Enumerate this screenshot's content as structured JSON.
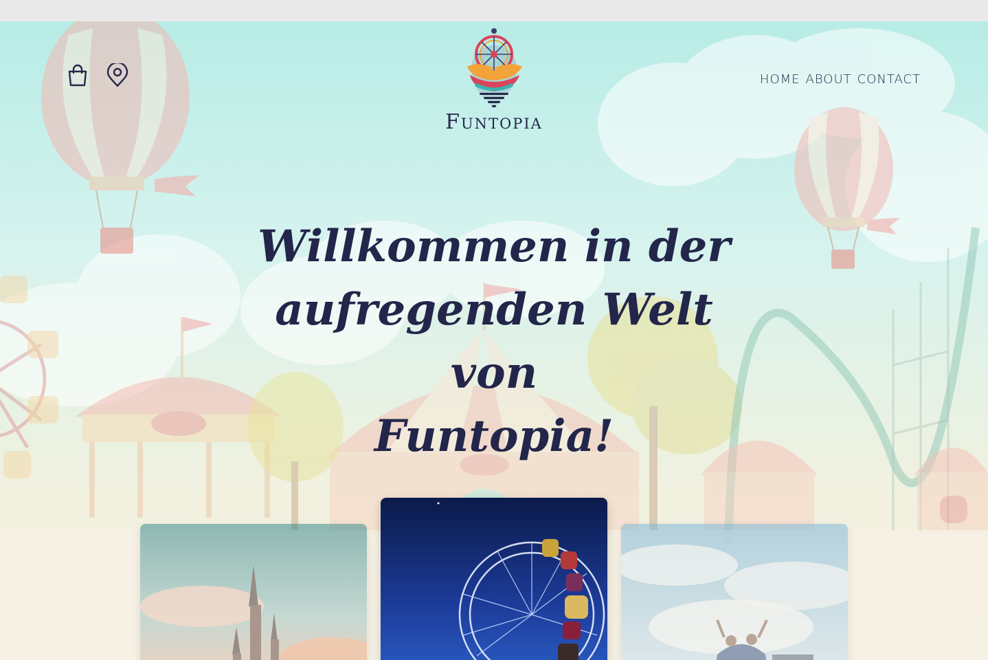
{
  "brand": {
    "name": "Funtopia"
  },
  "header": {
    "icons": [
      "shopping-bag-icon",
      "location-pin-icon"
    ],
    "nav": [
      {
        "label": "HOME"
      },
      {
        "label": "ABOUT"
      },
      {
        "label": "CONTACT"
      }
    ]
  },
  "hero": {
    "line1": "Willkommen in der",
    "line2": "aufregenden Welt von",
    "line3": "Funtopia!"
  },
  "cards": [
    {
      "image": "castle-photo"
    },
    {
      "image": "ferris-wheel-night-photo"
    },
    {
      "image": "roller-coaster-riders-photo"
    }
  ],
  "colors": {
    "text": "#26284a",
    "sky": "#b8ece6",
    "balloon": "#f2a3a3"
  }
}
